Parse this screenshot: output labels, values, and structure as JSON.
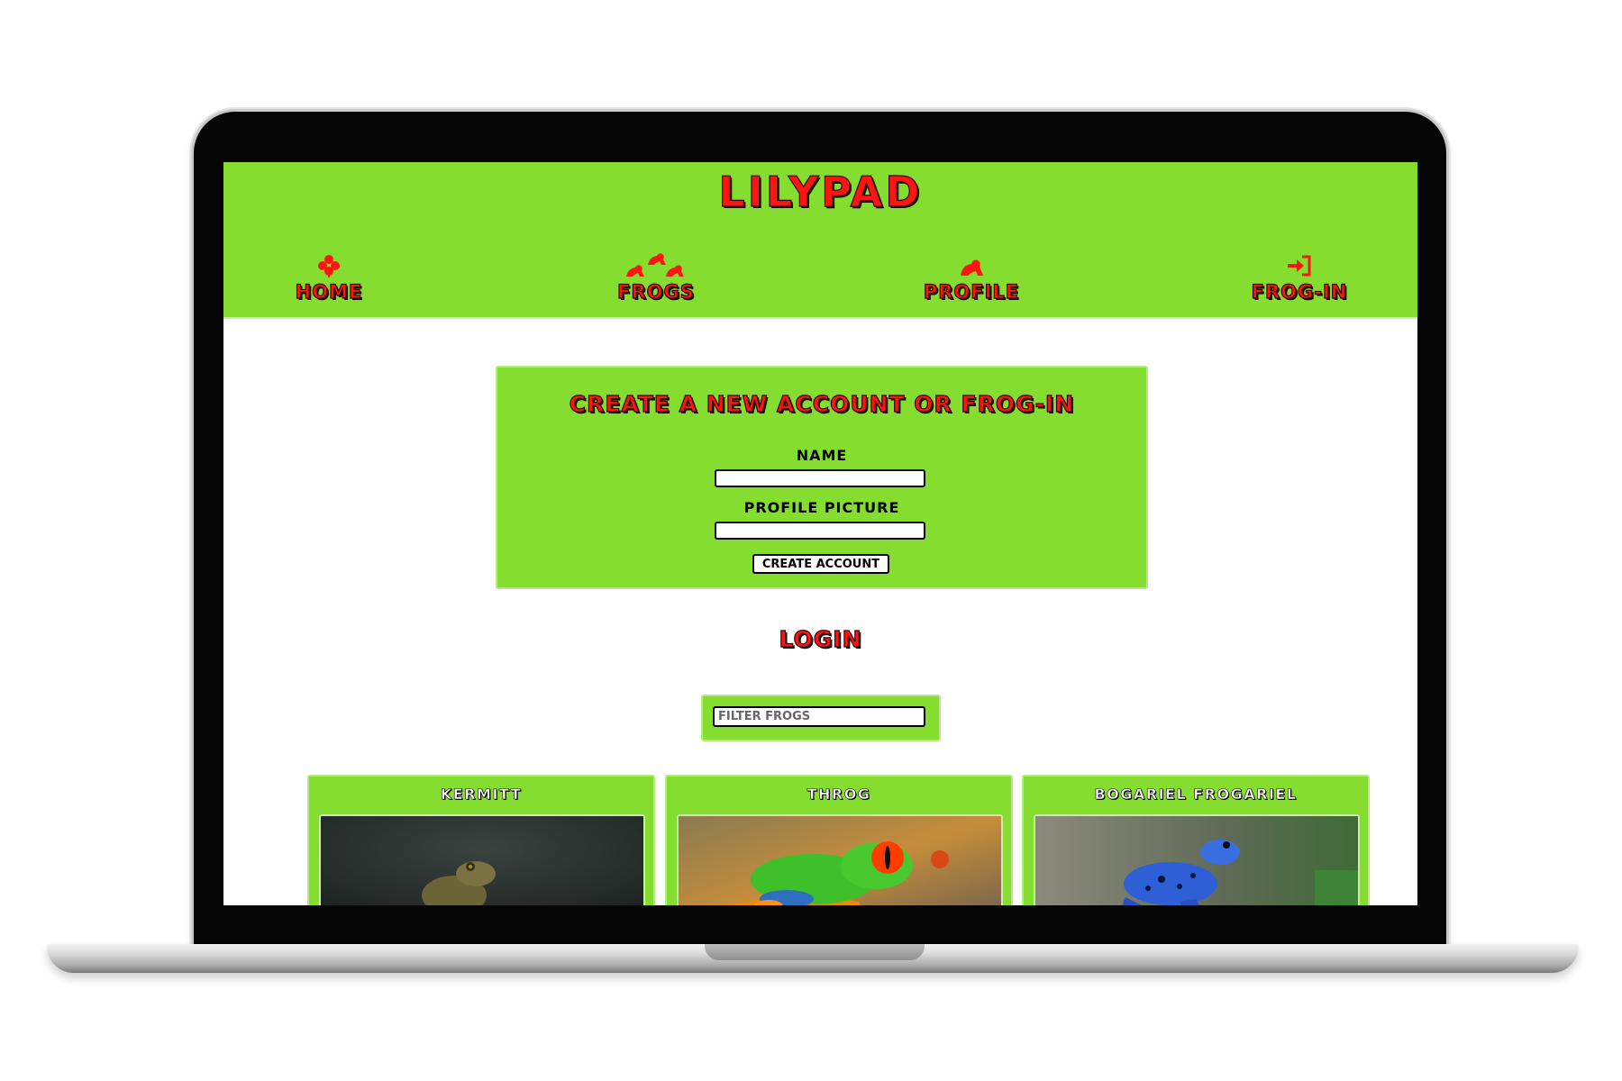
{
  "site": {
    "title": "LILYPAD"
  },
  "nav": {
    "items": [
      {
        "label": "HOME",
        "icon": "clover-icon"
      },
      {
        "label": "FROGS",
        "icon": "frogs-icon"
      },
      {
        "label": "PROFILE",
        "icon": "frog-icon"
      },
      {
        "label": "FROG-IN",
        "icon": "sign-in-icon"
      }
    ]
  },
  "signup": {
    "title": "CREATE A NEW ACCOUNT OR FROG-IN",
    "name_label": "NAME",
    "name_value": "",
    "picture_label": "PROFILE PICTURE",
    "picture_value": "",
    "submit_label": "CREATE ACCOUNT"
  },
  "login": {
    "title": "LOGIN"
  },
  "filter": {
    "placeholder": "FILTER FROGS",
    "value": ""
  },
  "frogs": [
    {
      "name": "KERMITT"
    },
    {
      "name": "THROG"
    },
    {
      "name": "BOGARIEL FROGARIEL"
    }
  ],
  "colors": {
    "accent": "#84dd2f",
    "title_red": "#ff1414",
    "frame": "#050505"
  }
}
